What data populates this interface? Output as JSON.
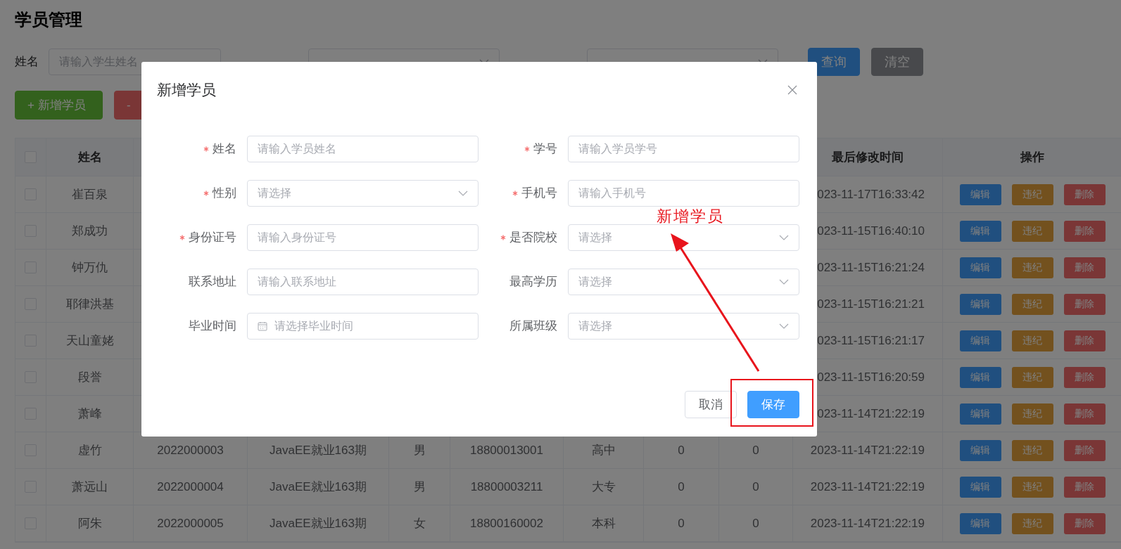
{
  "page_title": "学员管理",
  "filters": [
    {
      "kind": "input",
      "label": "姓名",
      "placeholder": "请输入学生姓名"
    },
    {
      "kind": "select"
    },
    {
      "kind": "select"
    }
  ],
  "filter_buttons": [
    {
      "kind": "primary",
      "label": "查询"
    },
    {
      "kind": "neutral",
      "label": "清空"
    }
  ],
  "toolbar_buttons": [
    {
      "kind": "success",
      "label": "+ 新增学员"
    },
    {
      "kind": "danger",
      "label": "-"
    }
  ],
  "table": {
    "header_checked": false,
    "name_label": "姓名",
    "last_modified_label": "最后修改时间",
    "actions_label": "操作",
    "rows": [
      {
        "checked": false,
        "name": "崔百泉",
        "last_modified": "023-11-17T16:33:42",
        "actions": [
          "编辑",
          "违纪",
          "删除"
        ]
      },
      {
        "checked": false,
        "name": "郑成功",
        "last_modified": "023-11-15T16:40:10",
        "actions": [
          "编辑",
          "违纪",
          "删除"
        ]
      },
      {
        "checked": false,
        "name": "钟万仇",
        "last_modified": "023-11-15T16:21:24",
        "actions": [
          "编辑",
          "违纪",
          "删除"
        ]
      },
      {
        "checked": false,
        "name": "耶律洪基",
        "last_modified": "023-11-15T16:21:21",
        "actions": [
          "编辑",
          "违纪",
          "删除"
        ]
      },
      {
        "checked": false,
        "name": "天山童姥",
        "last_modified": "023-11-15T16:21:17",
        "actions": [
          "编辑",
          "违纪",
          "删除"
        ]
      },
      {
        "checked": false,
        "name": "段誉",
        "last_modified": "023-11-15T16:20:59",
        "actions": [
          "编辑",
          "违纪",
          "删除"
        ]
      },
      {
        "checked": false,
        "name": "萧峰",
        "last_modified": "023-11-14T21:22:19",
        "actions": [
          "编辑",
          "违纪",
          "删除"
        ]
      },
      {
        "checked": false,
        "name": "虚竹",
        "cells": [
          "2022000003",
          "JavaEE就业163期",
          "男",
          "18800013001",
          "高中",
          "0",
          "0"
        ],
        "last_modified": "2023-11-14T21:22:19",
        "actions": [
          "编辑",
          "违纪",
          "删除"
        ]
      },
      {
        "checked": false,
        "name": "萧远山",
        "cells": [
          "2022000004",
          "JavaEE就业163期",
          "男",
          "18800003211",
          "大专",
          "0",
          "0"
        ],
        "last_modified": "2023-11-14T21:22:19",
        "actions": [
          "编辑",
          "违纪",
          "删除"
        ]
      },
      {
        "checked": false,
        "name": "阿朱",
        "cells": [
          "2022000005",
          "JavaEE就业163期",
          "女",
          "18800160002",
          "本科",
          "0",
          "0"
        ],
        "last_modified": "2023-11-14T21:22:19",
        "actions": [
          "编辑",
          "违纪",
          "删除"
        ]
      }
    ]
  },
  "dialog": {
    "title": "新增学员",
    "fields": [
      {
        "kind": "input",
        "label": "姓名",
        "required": true,
        "placeholder": "请输入学员姓名"
      },
      {
        "kind": "input",
        "label": "学号",
        "required": true,
        "placeholder": "请输入学员学号"
      },
      {
        "kind": "select",
        "label": "性别",
        "required": true,
        "placeholder": "请选择"
      },
      {
        "kind": "input",
        "label": "手机号",
        "required": true,
        "placeholder": "请输入手机号"
      },
      {
        "kind": "input",
        "label": "身份证号",
        "required": true,
        "placeholder": "请输入身份证号"
      },
      {
        "kind": "select",
        "label": "是否院校",
        "required": true,
        "placeholder": "请选择"
      },
      {
        "kind": "input",
        "label": "联系地址",
        "required": false,
        "placeholder": "请输入联系地址"
      },
      {
        "kind": "select",
        "label": "最高学历",
        "required": false,
        "placeholder": "请选择"
      },
      {
        "kind": "date",
        "label": "毕业时间",
        "required": false,
        "placeholder": "请选择毕业时间"
      },
      {
        "kind": "select",
        "label": "所属班级",
        "required": false,
        "placeholder": "请选择"
      }
    ],
    "buttons": [
      {
        "kind": "default",
        "label": "取消"
      },
      {
        "kind": "primary",
        "label": "保存"
      }
    ]
  },
  "annotation": {
    "text": "新增学员"
  }
}
